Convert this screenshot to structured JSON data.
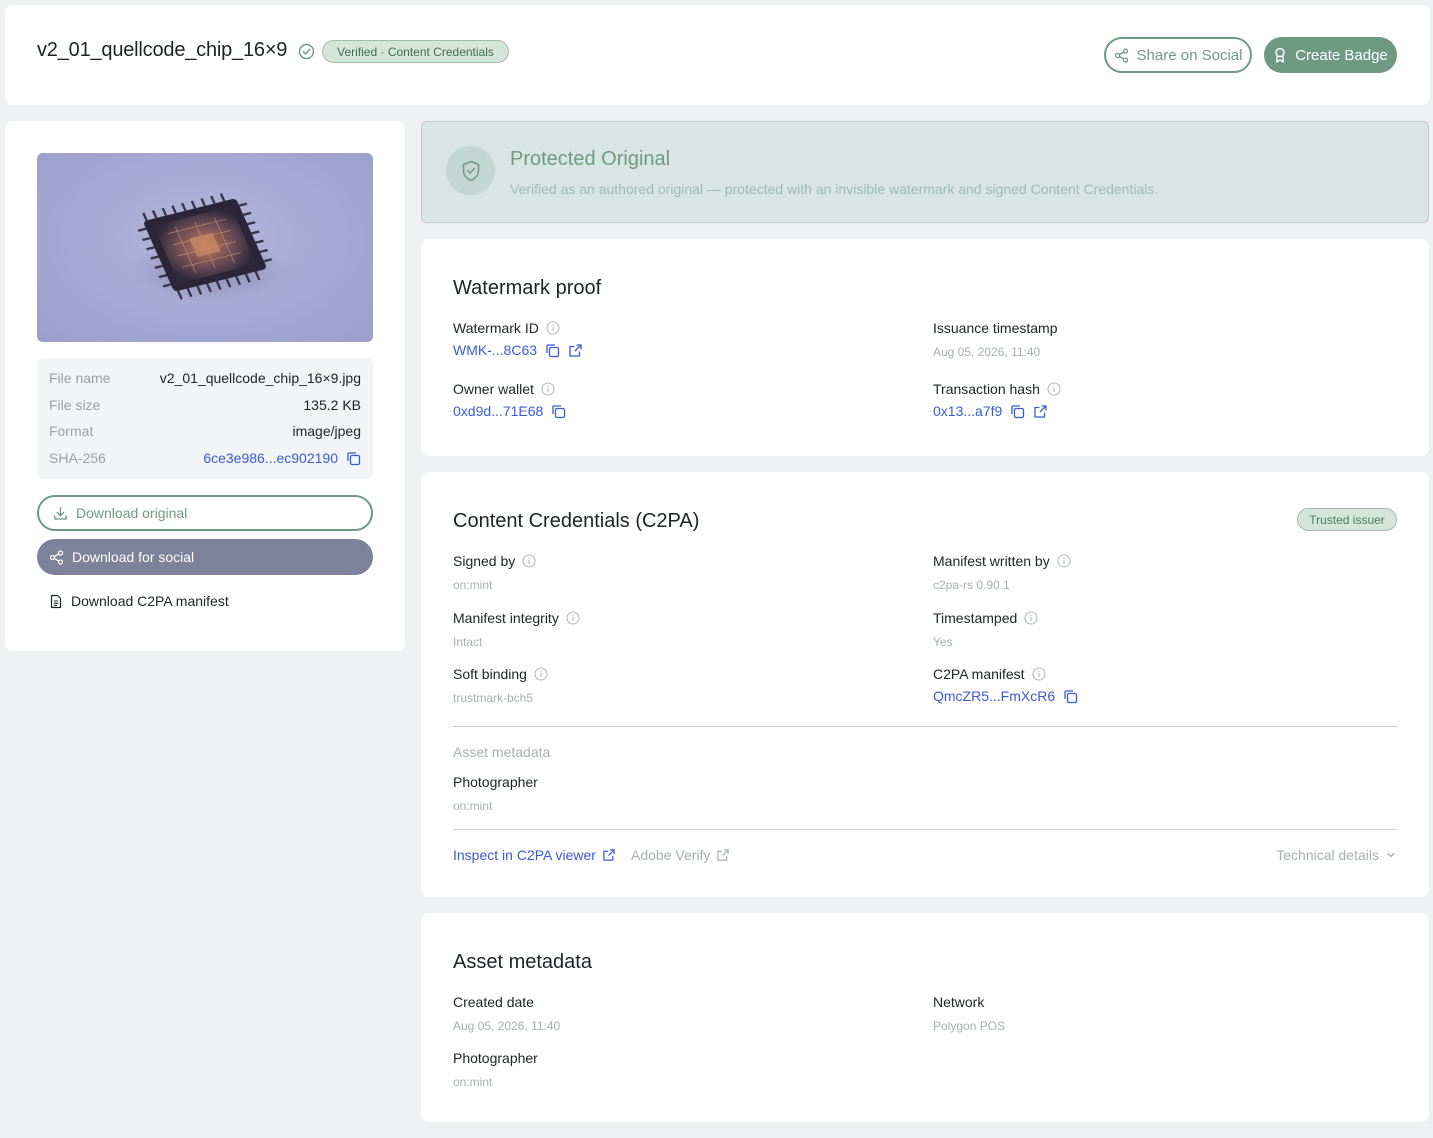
{
  "header": {
    "title": "v2_01_quellcode_chip_16×9",
    "verified_pill": "Verified · Content Credentials",
    "share_label": "Share on Social",
    "badge_label": "Create Badge"
  },
  "file": {
    "rows": [
      {
        "key": "File name",
        "value": "v2_01_quellcode_chip_16×9.jpg"
      },
      {
        "key": "File size",
        "value": "135.2 KB"
      },
      {
        "key": "Format",
        "value": "image/jpeg"
      },
      {
        "key": "SHA-256",
        "value": "6ce3e986...ec902190"
      }
    ],
    "download_original": "Download original",
    "download_social": "Download for social",
    "download_manifest": "Download C2PA manifest"
  },
  "banner": {
    "title": "Protected Original",
    "subtitle": "Verified as an authored original — protected with an invisible watermark and signed Content Credentials."
  },
  "watermark": {
    "title": "Watermark proof",
    "watermark_id_label": "Watermark ID",
    "watermark_id_value": "WMK-...8C63",
    "issuance_label": "Issuance timestamp",
    "issuance_value": "Aug 05, 2026, 11:40",
    "owner_label": "Owner wallet",
    "owner_value": "0xd9d...71E68",
    "tx_label": "Transaction hash",
    "tx_value": "0x13...a7f9"
  },
  "c2pa": {
    "title": "Content Credentials (C2PA)",
    "trusted": "Trusted issuer",
    "signed_by_label": "Signed by",
    "signed_by_value": "on:mint",
    "written_by_label": "Manifest written by",
    "written_by_value": "c2pa-rs 0.90.1",
    "integrity_label": "Manifest integrity",
    "integrity_value": "Intact",
    "timestamped_label": "Timestamped",
    "timestamped_value": "Yes",
    "soft_binding_label": "Soft binding",
    "soft_binding_value": "trustmark-bch5",
    "manifest_label": "C2PA manifest",
    "manifest_value": "QmcZR5...FmXcR6",
    "asset_metadata_subhead": "Asset metadata",
    "photographer_label": "Photographer",
    "photographer_value": "on:mint",
    "inspect_link": "Inspect in C2PA viewer",
    "adobe_link": "Adobe Verify",
    "technical_details": "Technical details"
  },
  "asset": {
    "title": "Asset metadata",
    "created_label": "Created date",
    "created_value": "Aug 05, 2026, 11:40",
    "network_label": "Network",
    "network_value": "Polygon POS",
    "photographer_label": "Photographer",
    "photographer_value": "on:mint"
  },
  "colors": {
    "accent_green": "#6f9a82",
    "link_blue": "#3a5bd9",
    "social_button": "#7b8299"
  }
}
